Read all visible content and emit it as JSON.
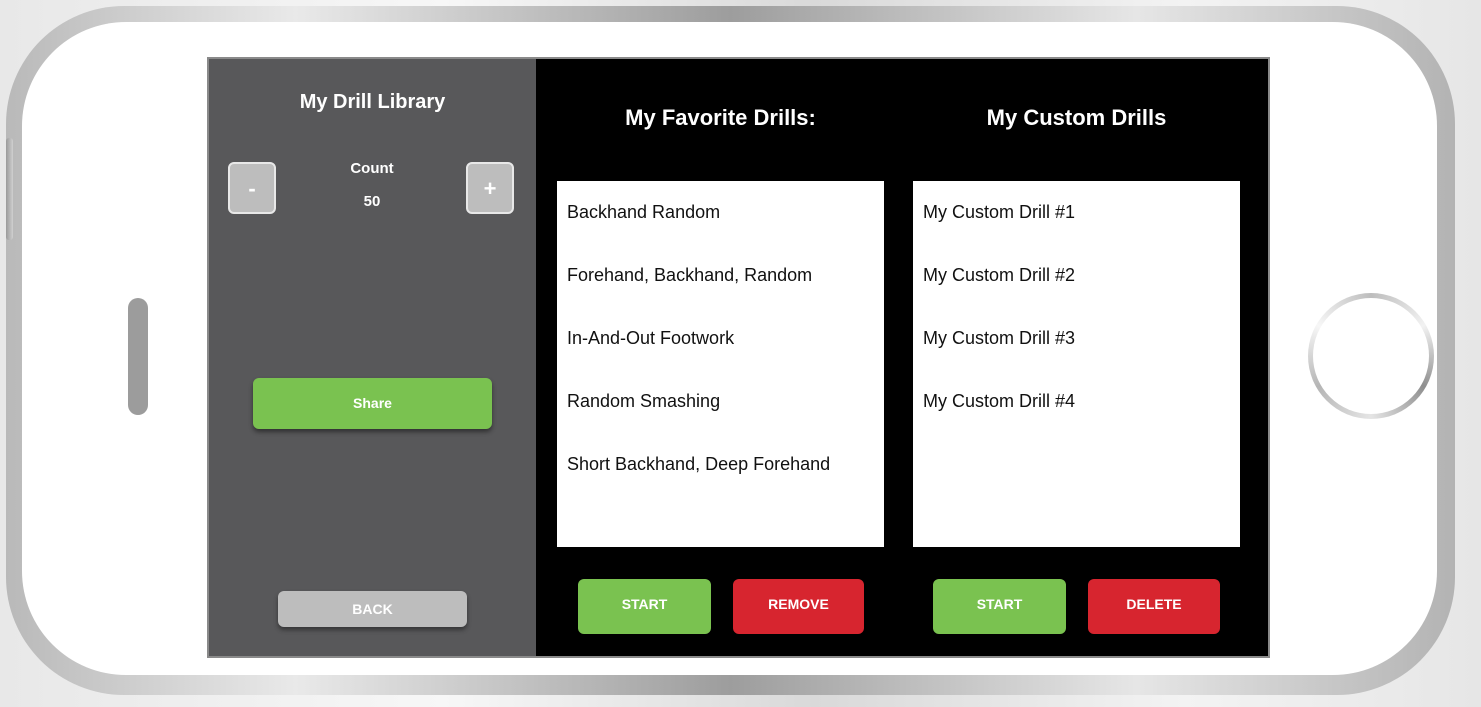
{
  "left_panel": {
    "title": "My Drill Library",
    "minus_label": "-",
    "plus_label": "+",
    "count_label": "Count",
    "count_value": "50",
    "share_label": "Share",
    "back_label": "BACK"
  },
  "favorites": {
    "title": "My Favorite Drills:",
    "items": [
      "Backhand Random",
      "Forehand, Backhand, Random",
      "In-And-Out Footwork",
      "Random Smashing",
      "Short Backhand, Deep Forehand"
    ],
    "start_label": "START",
    "remove_label": "REMOVE"
  },
  "custom": {
    "title": "My Custom Drills",
    "items": [
      "My Custom Drill #1",
      "My Custom Drill #2",
      "My Custom Drill #3",
      "My Custom Drill #4"
    ],
    "start_label": "START",
    "delete_label": "DELETE"
  },
  "colors": {
    "left_panel_bg": "#58585a",
    "green": "#7ac250",
    "red": "#d7252f",
    "gray_button": "#bdbdbd"
  }
}
